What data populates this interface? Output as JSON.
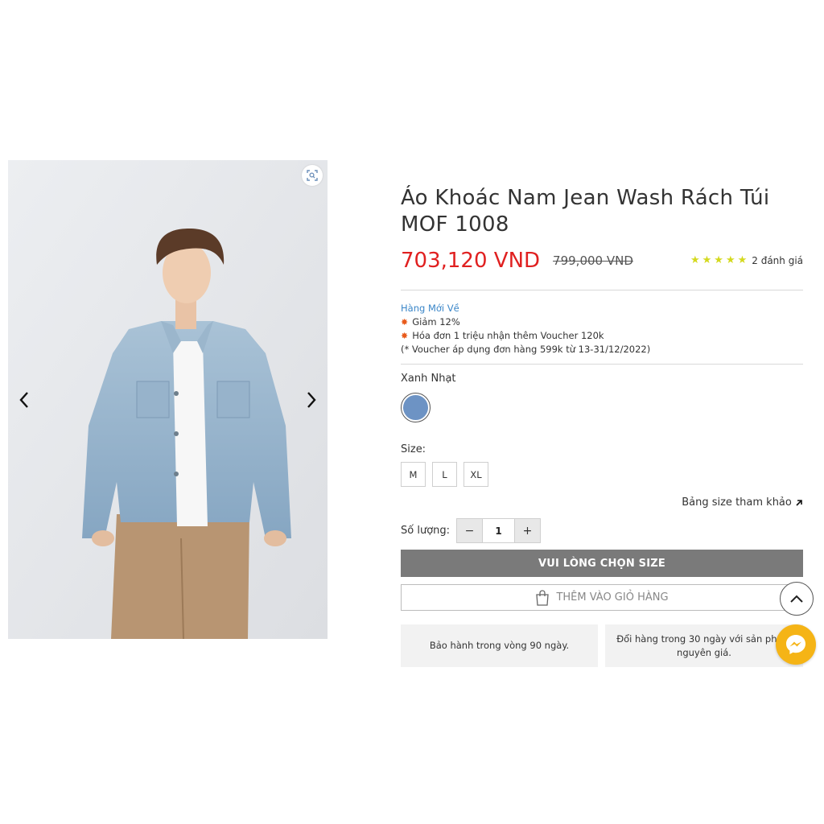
{
  "product": {
    "title": "Áo Khoác Nam Jean Wash Rách Túi MOF 1008",
    "price": "703,120 VND",
    "old_price": "799,000 VND",
    "rating_stars": 5,
    "rating_text": "2 đánh giá",
    "color_label": "Xanh Nhạt",
    "color_swatch": "#6d93c4",
    "size_label": "Size:",
    "sizes": [
      "M",
      "L",
      "XL"
    ],
    "size_guide": "Bảng size tham khảo"
  },
  "promo": {
    "new_tag": "Hàng Mới Về",
    "line1": "Giảm 12%",
    "line2": "Hóa đơn 1 triệu nhận thêm Voucher 120k",
    "note": "(* Voucher áp dụng đơn hàng 599k từ 13-31/12/2022)"
  },
  "quantity": {
    "label": "Số lượng:",
    "minus": "−",
    "value": "1",
    "plus": "+"
  },
  "actions": {
    "primary_label": "VUI LÒNG CHỌN SIZE",
    "cart_label": "THÊM VÀO GIỎ HÀNG"
  },
  "perks": [
    "Bảo hành trong vòng 90 ngày.",
    "Đổi hàng trong 30 ngày với sản phẩm nguyên giá."
  ],
  "icons": {
    "zoom": "zoom-icon",
    "prev": "chevron-left-icon",
    "next": "chevron-right-icon",
    "bag": "shopping-bag-icon",
    "scroll_top": "chevron-up-icon",
    "messenger": "messenger-icon",
    "star": "star-icon",
    "promo_burst": "burst-icon",
    "external_arrow": "arrow-up-right-icon"
  },
  "colors": {
    "price_red": "#e02020",
    "new_tag_blue": "#3a86c8",
    "primary_button": "#7a7a7a",
    "star_yellow": "#d4d91e",
    "messenger_bg": "#f5b416"
  }
}
